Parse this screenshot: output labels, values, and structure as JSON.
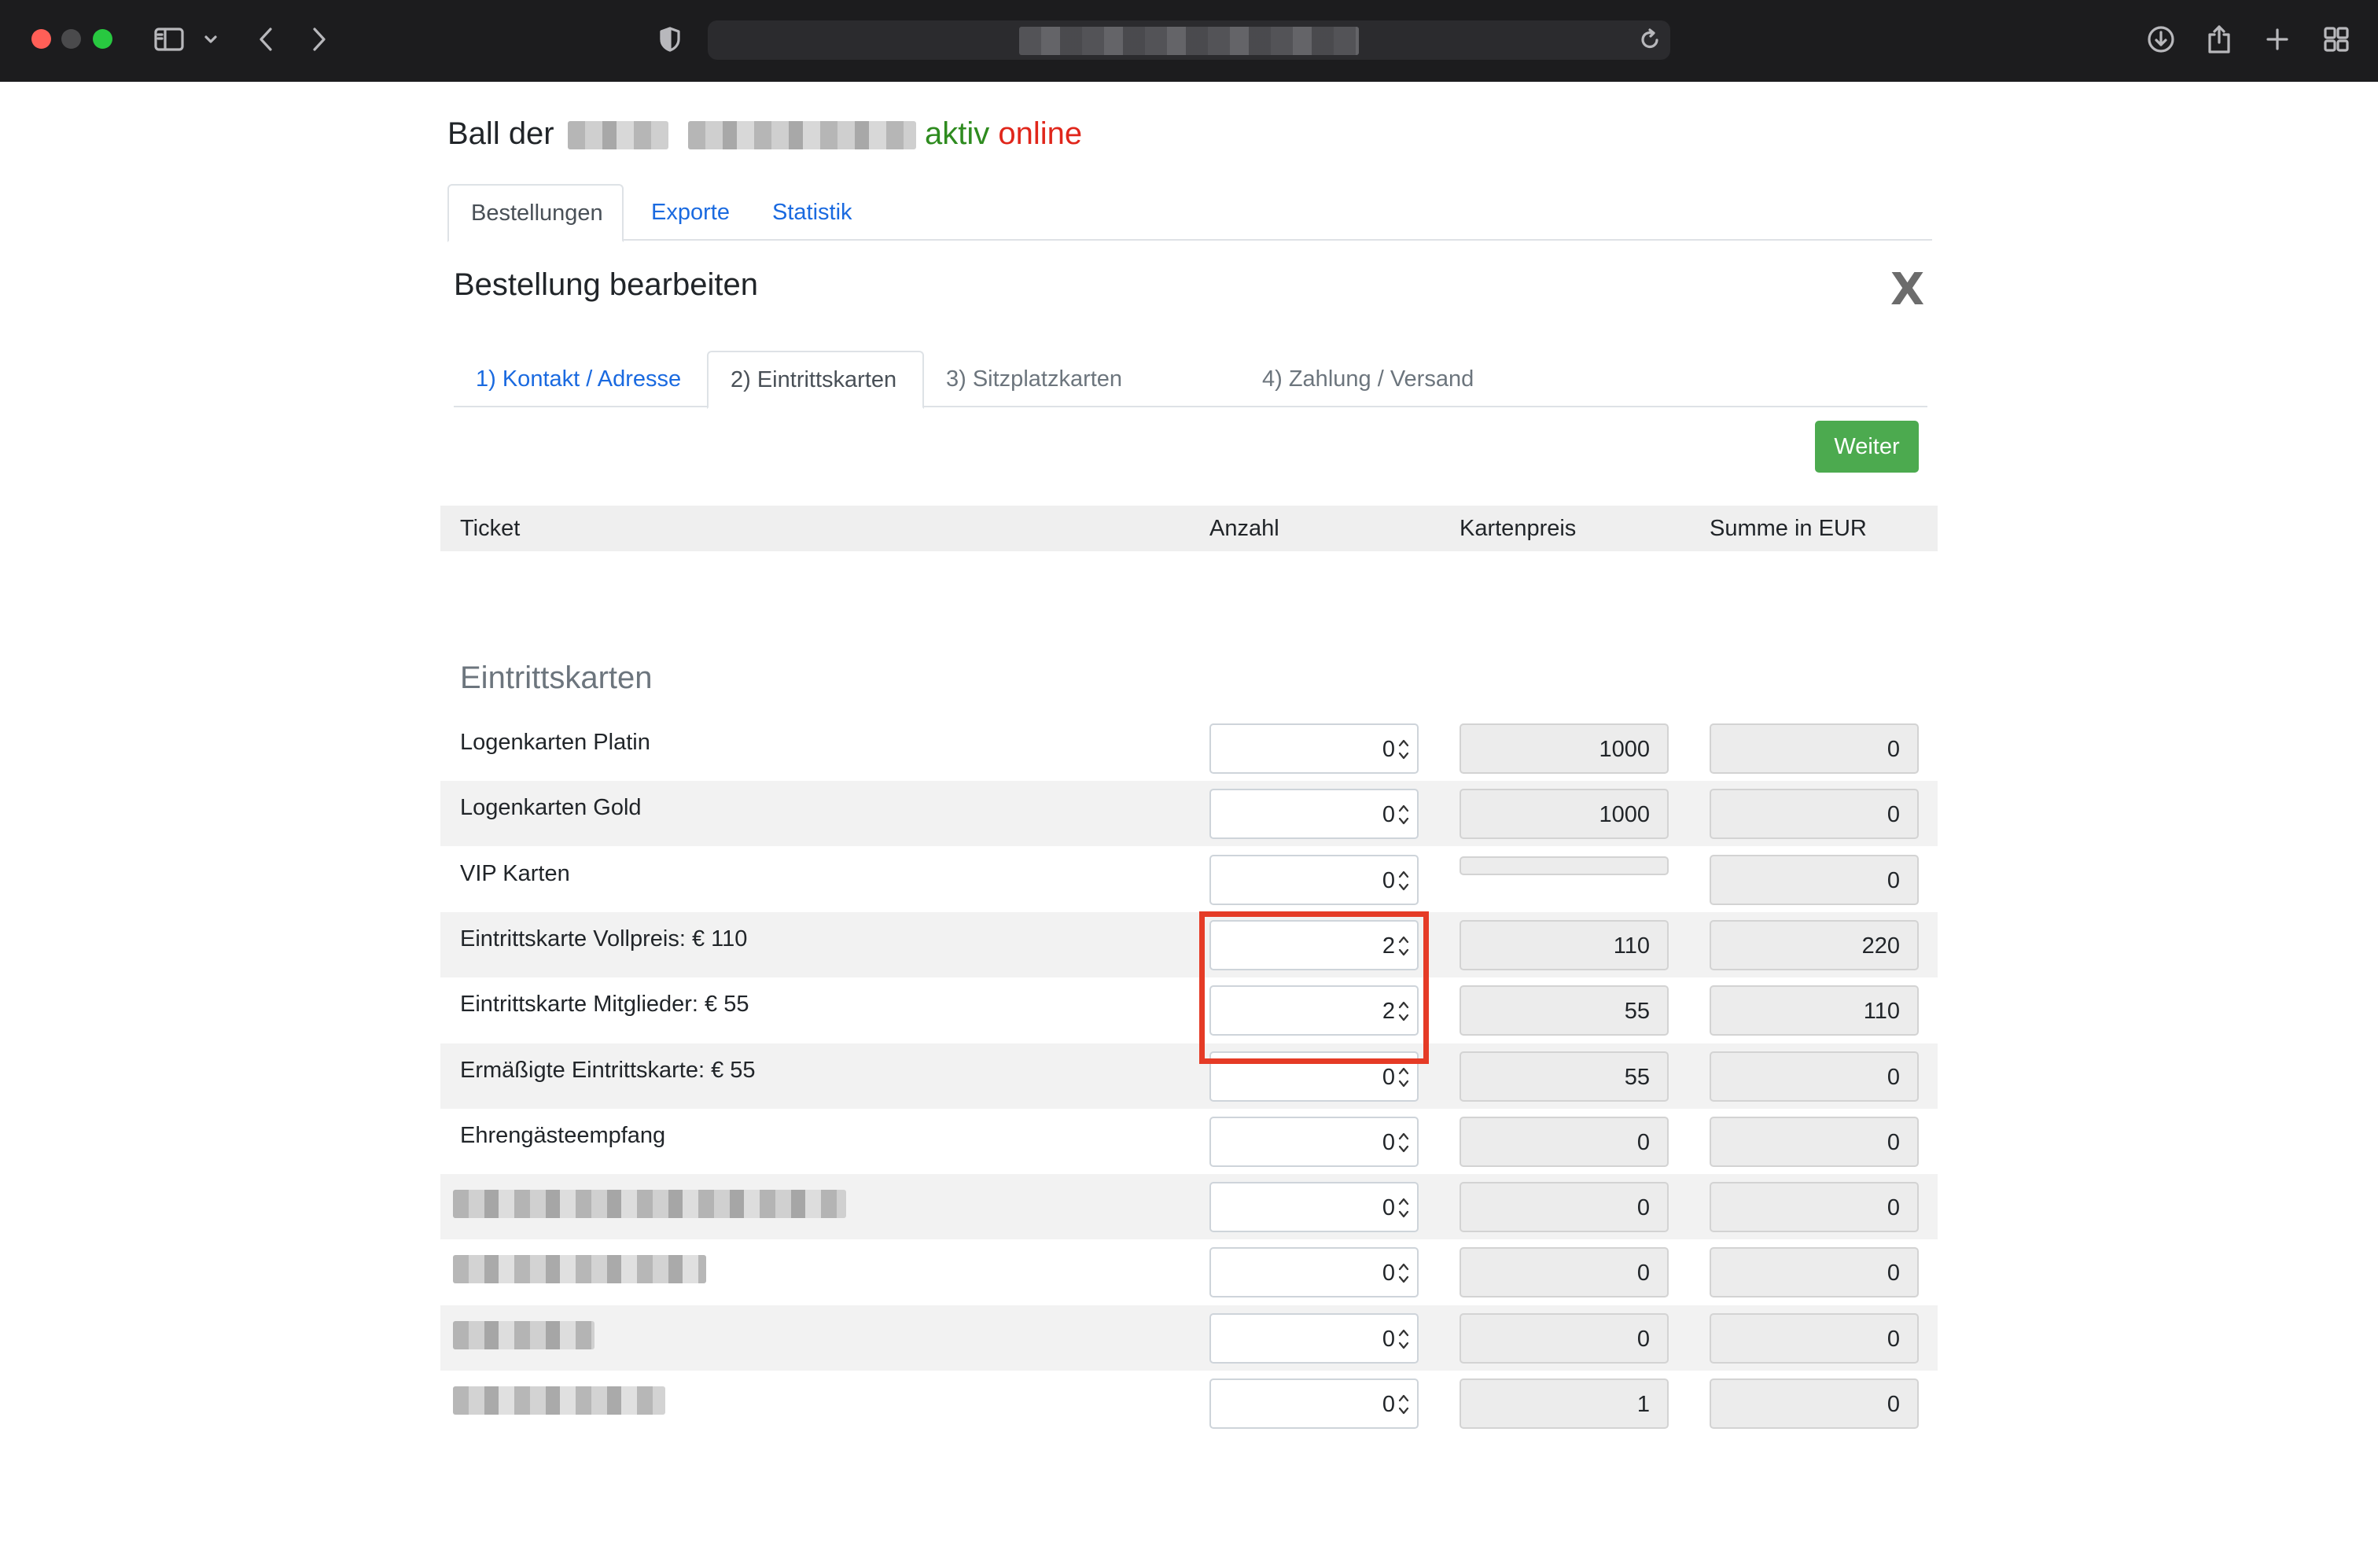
{
  "browser": {
    "icons": [
      "sidebar-icon",
      "chevron-down-icon",
      "back-icon",
      "forward-icon",
      "shield-icon",
      "reload-icon",
      "download-icon",
      "share-icon",
      "new-tab-icon",
      "tab-overview-icon"
    ]
  },
  "header": {
    "title_prefix": "Ball der",
    "status_aktiv": "aktiv",
    "status_online": "online",
    "colors": {
      "aktiv": "#2e8b1f",
      "online": "#e0261b"
    }
  },
  "main_tabs": [
    {
      "label": "Bestellungen",
      "active": true
    },
    {
      "label": "Exporte",
      "active": false
    },
    {
      "label": "Statistik",
      "active": false
    }
  ],
  "modal": {
    "title": "Bestellung bearbeiten",
    "close_label": "X"
  },
  "step_tabs": [
    {
      "label": "1) Kontakt / Adresse",
      "state": "link"
    },
    {
      "label": "2) Eintrittskarten",
      "state": "active"
    },
    {
      "label": "3) Sitzplatzkarten",
      "state": "disabled"
    },
    {
      "label": "4) Zahlung / Versand",
      "state": "disabled"
    }
  ],
  "weiter_label": "Weiter",
  "table": {
    "columns": [
      "Ticket",
      "Anzahl",
      "Kartenpreis",
      "Summe in EUR"
    ]
  },
  "section": {
    "title": "Eintrittskarten"
  },
  "rows": [
    {
      "label": "Logenkarten Platin",
      "qty": "0",
      "price": "1000",
      "sum": "0"
    },
    {
      "label": "Logenkarten Gold",
      "qty": "0",
      "price": "1000",
      "sum": "0"
    },
    {
      "label": "VIP Karten",
      "qty": "0",
      "price": "",
      "sum": "0"
    },
    {
      "label": "Eintrittskarte Vollpreis: € 110",
      "qty": "2",
      "price": "110",
      "sum": "220"
    },
    {
      "label": "Eintrittskarte Mitglieder: € 55",
      "qty": "2",
      "price": "55",
      "sum": "110"
    },
    {
      "label": "Ermäßigte Eintrittskarte: € 55",
      "qty": "0",
      "price": "55",
      "sum": "0"
    },
    {
      "label": "Ehrengästeempfang",
      "qty": "0",
      "price": "0",
      "sum": "0"
    },
    {
      "label": "",
      "qty": "0",
      "price": "0",
      "sum": "0"
    },
    {
      "label": "",
      "qty": "0",
      "price": "0",
      "sum": "0"
    },
    {
      "label": "",
      "qty": "0",
      "price": "0",
      "sum": "0"
    },
    {
      "label": "",
      "qty": "0",
      "price": "1",
      "sum": "0"
    }
  ]
}
